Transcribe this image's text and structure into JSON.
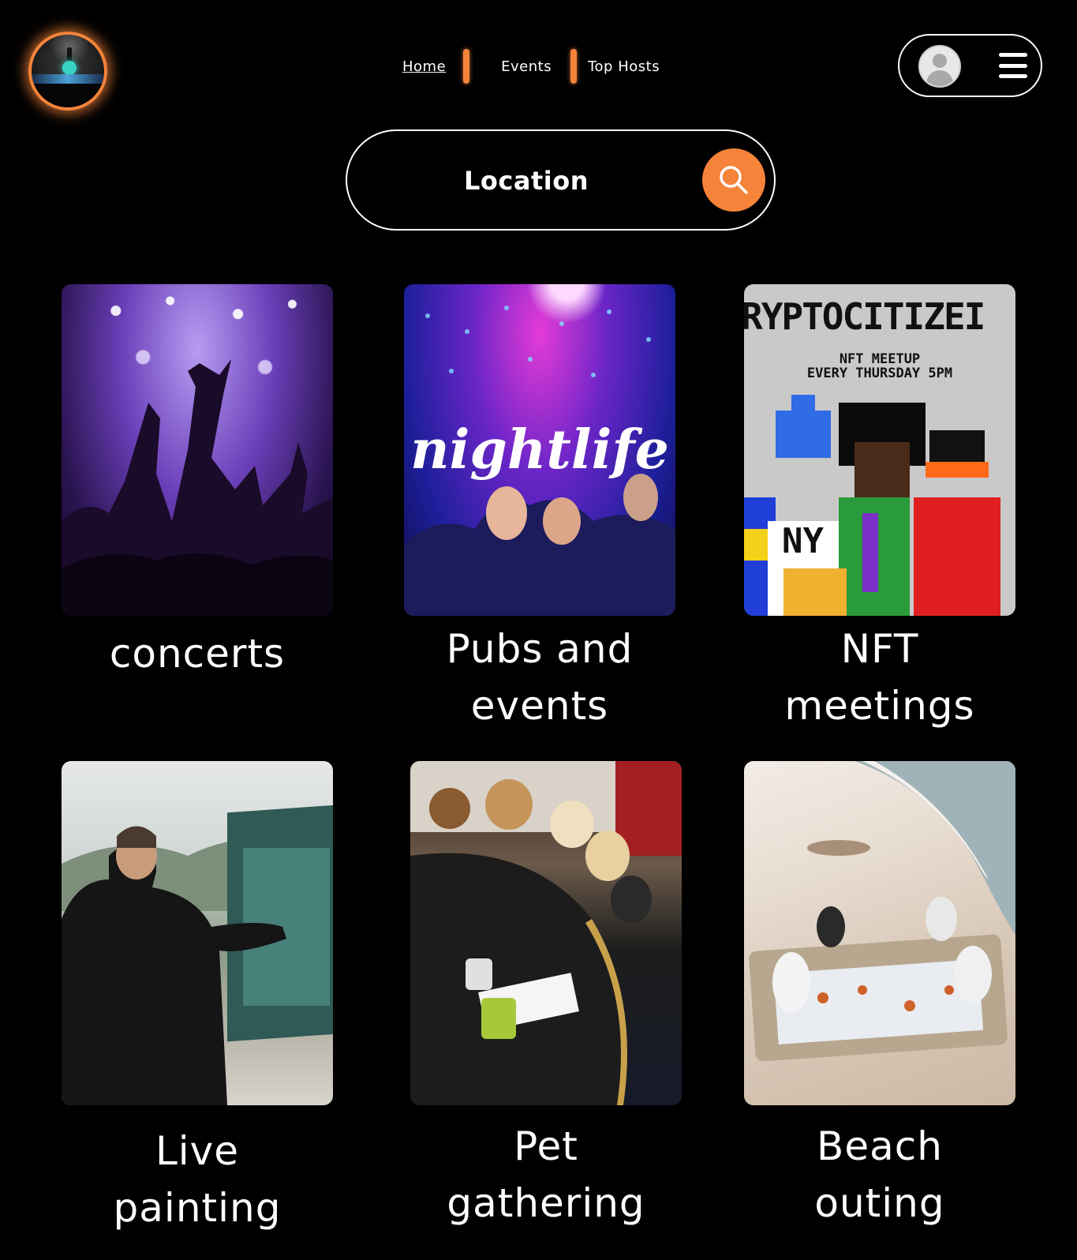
{
  "nav": {
    "items": [
      {
        "label": "Home",
        "active": true
      },
      {
        "label": "Events",
        "active": false
      },
      {
        "label": "Top Hosts",
        "active": false
      }
    ]
  },
  "search": {
    "placeholder": "Location"
  },
  "categories": [
    {
      "label_lines": [
        "concerts"
      ],
      "image": "concert-crowd"
    },
    {
      "label_lines": [
        "Pubs and",
        "events"
      ],
      "image": "nightlife",
      "image_text": "nightlife"
    },
    {
      "label_lines": [
        "NFT",
        "meetings"
      ],
      "image": "nft-meetup",
      "image_text": {
        "title": "RYPTOCITIZEI",
        "line1": "NFT MEETUP",
        "line2": "EVERY THURSDAY 5PM",
        "badge": "NY"
      }
    },
    {
      "label_lines": [
        "Live",
        "painting"
      ],
      "image": "live-painting"
    },
    {
      "label_lines": [
        "Pet",
        "gathering"
      ],
      "image": "dogs-at-table"
    },
    {
      "label_lines": [
        "Beach",
        "outing"
      ],
      "image": "beach-picnic"
    }
  ],
  "colors": {
    "background": "#000000",
    "accent": "#f5843a",
    "text": "#ffffff"
  },
  "icons": [
    "logo-icon",
    "avatar-icon",
    "menu-icon",
    "search-icon"
  ]
}
